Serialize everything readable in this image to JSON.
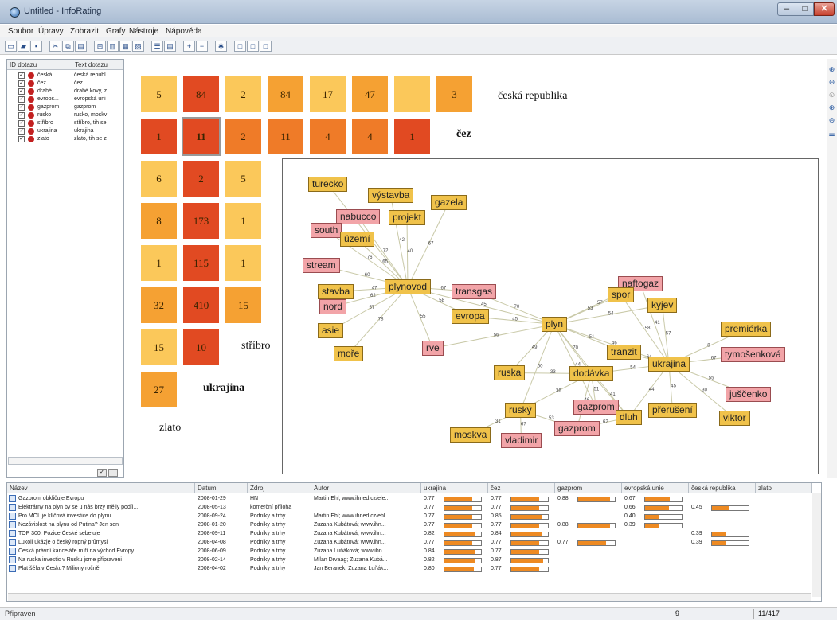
{
  "window": {
    "title": "Untitled - InfoRating",
    "min": "–",
    "max": "□",
    "close": "✕"
  },
  "menu": [
    "Soubor",
    "Úpravy",
    "Zobrazit",
    "Grafy",
    "Nástroje",
    "Nápověda"
  ],
  "left_panel": {
    "headers": [
      "ID dotazu",
      "Text dotazu"
    ],
    "queries": [
      {
        "id": "česká ...",
        "text": "česká republ"
      },
      {
        "id": "čez",
        "text": "čez"
      },
      {
        "id": "drahé ...",
        "text": "drahé kovy, z"
      },
      {
        "id": "evrops...",
        "text": "evropská uni"
      },
      {
        "id": "gazprom",
        "text": "gazprom"
      },
      {
        "id": "rusko",
        "text": "rusko, moskv"
      },
      {
        "id": "stříbro",
        "text": "stříbro, tih se"
      },
      {
        "id": "ukrajina",
        "text": "ukrajina"
      },
      {
        "id": "zlato",
        "text": "zlato, tih se z"
      }
    ]
  },
  "matrix": {
    "cells": [
      [
        "5",
        "84",
        "2",
        "84",
        "17",
        "47",
        "",
        "3"
      ],
      [
        "1",
        "11",
        "2",
        "11",
        "4",
        "4",
        "1"
      ],
      [
        "6",
        "2",
        "5"
      ],
      [
        "8",
        "173",
        "1"
      ],
      [
        "1",
        "115",
        "1"
      ],
      [
        "32",
        "410",
        "15"
      ],
      [
        "15",
        "10"
      ],
      [
        "27"
      ]
    ],
    "labels": {
      "ceska_republika": "česká republika",
      "cez": "čez",
      "stribro": "stříbro",
      "ukrajina": "ukrajina",
      "zlato": "zlato"
    }
  },
  "network": {
    "nodes": [
      "turecko",
      "výstavba",
      "gazela",
      "nabucco",
      "projekt",
      "south",
      "území",
      "stream",
      "plynovod",
      "transgas",
      "naftogaz",
      "spor",
      "kyjev",
      "stavba",
      "nord",
      "evropa",
      "plyn",
      "asie",
      "moře",
      "rve",
      "premiérka",
      "tymošenková",
      "tranzit",
      "ukrajina",
      "ruska",
      "dodávka",
      "juščenko",
      "ruský",
      "gazprom_pink",
      "dluh",
      "přerušení",
      "viktor",
      "moskva",
      "vladimir",
      "gazprom"
    ],
    "labels": {
      "turecko": "turecko",
      "výstavba": "výstavba",
      "gazela": "gazela",
      "nabucco": "nabucco",
      "projekt": "projekt",
      "south": "south",
      "území": "území",
      "stream": "stream",
      "plynovod": "plynovod",
      "transgas": "transgas",
      "naftogaz": "naftogaz",
      "spor": "spor",
      "kyjev": "kyjev",
      "stavba": "stavba",
      "nord": "nord",
      "evropa": "evropa",
      "plyn": "plyn",
      "asie": "asie",
      "moře": "moře",
      "rve": "rve",
      "premiérka": "premiérka",
      "tymošenková": "tymošenková",
      "tranzit": "tranzit",
      "ukrajina": "ukrajina",
      "ruska": "ruska",
      "dodávka": "dodávka",
      "juščenko": "juščenko",
      "ruský": "ruský",
      "gazprom_pink": "gazprom",
      "dluh": "dluh",
      "přerušení": "přerušení",
      "viktor": "viktor",
      "moskva": "moskva",
      "vladimir": "vladimir",
      "gazprom": "gazprom"
    },
    "edges": [
      [
        "turecko",
        "plynovod",
        "61"
      ],
      [
        "výstavba",
        "plynovod",
        "42"
      ],
      [
        "gazela",
        "plynovod",
        "67"
      ],
      [
        "nabucco",
        "plynovod",
        "72"
      ],
      [
        "projekt",
        "plynovod",
        "40"
      ],
      [
        "south",
        "plynovod",
        "76"
      ],
      [
        "území",
        "plynovod",
        "65"
      ],
      [
        "stream",
        "plynovod",
        "60"
      ],
      [
        "stavba",
        "plynovod",
        "47"
      ],
      [
        "nord",
        "plynovod",
        "62"
      ],
      [
        "asie",
        "plynovod",
        "57"
      ],
      [
        "moře",
        "plynovod",
        "78"
      ],
      [
        "plynovod",
        "transgas",
        "67"
      ],
      [
        "plynovod",
        "evropa",
        "58"
      ],
      [
        "plynovod",
        "rve",
        "55"
      ],
      [
        "plynovod",
        "plyn",
        "45"
      ],
      [
        "evropa",
        "plyn",
        "45"
      ],
      [
        "rve",
        "plyn",
        "56"
      ],
      [
        "transgas",
        "plyn",
        "70"
      ],
      [
        "plyn",
        "naftogaz",
        "57"
      ],
      [
        "plyn",
        "spor",
        "53"
      ],
      [
        "plyn",
        "kyjev",
        "54"
      ],
      [
        "plyn",
        "tranzit",
        "51"
      ],
      [
        "plyn",
        "ukrajina",
        "46"
      ],
      [
        "plyn",
        "ruska",
        "49"
      ],
      [
        "plyn",
        "dodávka",
        "70"
      ],
      [
        "plyn",
        "ruský",
        "60"
      ],
      [
        "plyn",
        "gazprom_pink",
        "44"
      ],
      [
        "plyn",
        "dluh",
        "49"
      ],
      [
        "kyjev",
        "ukrajina",
        "57"
      ],
      [
        "spor",
        "ukrajina",
        "58"
      ],
      [
        "naftogaz",
        "ukrajina",
        "41"
      ],
      [
        "tranzit",
        "ukrajina",
        "64"
      ],
      [
        "ukrajina",
        "premiérka",
        "8"
      ],
      [
        "ukrajina",
        "tymošenková",
        "67"
      ],
      [
        "ukrajina",
        "juščenko",
        "55"
      ],
      [
        "ukrajina",
        "viktor",
        "30"
      ],
      [
        "ukrajina",
        "přerušení",
        "45"
      ],
      [
        "ukrajina",
        "dodávka",
        "54"
      ],
      [
        "ukrajina",
        "dluh",
        "44"
      ],
      [
        "ruska",
        "dodávka",
        "33"
      ],
      [
        "dodávka",
        "ruský",
        "36"
      ],
      [
        "dodávka",
        "gazprom",
        "46"
      ],
      [
        "dodávka",
        "dluh",
        "41"
      ],
      [
        "ruský",
        "moskva",
        "31"
      ],
      [
        "ruský",
        "vladimir",
        "67"
      ],
      [
        "ruský",
        "gazprom",
        "53"
      ],
      [
        "gazprom_pink",
        "dodávka",
        "51"
      ],
      [
        "gazprom",
        "dluh",
        "62"
      ]
    ]
  },
  "bottom_table": {
    "headers": [
      "Název",
      "Datum",
      "Zdroj",
      "Autor",
      "ukrajina",
      "čez",
      "gazprom",
      "evropská unie",
      "česká republika",
      "zlato"
    ],
    "rows": [
      {
        "title": "Gazprom obkličuje Evropu",
        "date": "2008-01-29",
        "source": "HN",
        "author": "Martin Ehl; www.ihned.cz/ele...",
        "ukr": "0.77",
        "ukr_fill": 0.77,
        "cez": "0.77",
        "cez_fill": 0.77,
        "gaz": "0.88",
        "gaz_fill": 0.88,
        "eu": "0.67",
        "eu_fill": 0.67,
        "cr": "",
        "cr_fill": 0
      },
      {
        "title": "Elektrárny na plyn by se u nás brzy mělly podíl...",
        "date": "2008-05-13",
        "source": "komerční příloha",
        "author": "",
        "ukr": "0.77",
        "ukr_fill": 0.77,
        "cez": "0.77",
        "cez_fill": 0.77,
        "gaz": "",
        "gaz_fill": 0,
        "eu": "0.66",
        "eu_fill": 0.66,
        "cr": "0.45",
        "cr_fill": 0.45
      },
      {
        "title": "Pro MOL je klíčová investice do plynu",
        "date": "2008-09-24",
        "source": "Podniky a trhy",
        "author": "Martin Ehl; www.ihned.cz/ehl",
        "ukr": "0.77",
        "ukr_fill": 0.77,
        "cez": "0.85",
        "cez_fill": 0.85,
        "gaz": "",
        "gaz_fill": 0,
        "eu": "0.40",
        "eu_fill": 0.4,
        "cr": "",
        "cr_fill": 0
      },
      {
        "title": "Nezávislost na plynu od Putina? Jen sen",
        "date": "2008-01-20",
        "source": "Podniky a trhy",
        "author": "Zuzana Kubátová; www.ihn...",
        "ukr": "0.77",
        "ukr_fill": 0.77,
        "cez": "0.77",
        "cez_fill": 0.77,
        "gaz": "0.88",
        "gaz_fill": 0.88,
        "eu": "0.39",
        "eu_fill": 0.39,
        "cr": "",
        "cr_fill": 0
      },
      {
        "title": "TOP 300: Pozice České sebeluje",
        "date": "2008-09-11",
        "source": "Podniky a trhy",
        "author": "Zuzana Kubátová; www.ihn...",
        "ukr": "0.82",
        "ukr_fill": 0.82,
        "cez": "0.84",
        "cez_fill": 0.84,
        "gaz": "",
        "gaz_fill": 0,
        "eu": "",
        "eu_fill": 0,
        "cr": "0.39",
        "cr_fill": 0.39
      },
      {
        "title": "Lukoil ukázje o český ropný průmysl",
        "date": "2008-04-08",
        "source": "Podniky a trhy",
        "author": "Zuzana Kubátová; www.ihn...",
        "ukr": "0.77",
        "ukr_fill": 0.77,
        "cez": "0.77",
        "cez_fill": 0.77,
        "gaz": "0.77",
        "gaz_fill": 0.77,
        "eu": "",
        "eu_fill": 0,
        "cr": "0.39",
        "cr_fill": 0.39
      },
      {
        "title": "Česká právní kanceláře míří na východ Evropy",
        "date": "2008-06-09",
        "source": "Podniky a trhy",
        "author": "Zuzana Luňáková; www.ihn...",
        "ukr": "0.84",
        "ukr_fill": 0.84,
        "cez": "0.77",
        "cez_fill": 0.77,
        "gaz": "",
        "gaz_fill": 0,
        "eu": "",
        "eu_fill": 0,
        "cr": "",
        "cr_fill": 0
      },
      {
        "title": "Na ruska investic v Rusku jsme připraveni",
        "date": "2008-02-14",
        "source": "Podniky a trhy",
        "author": "Milan Drvaag; Zuzana Kubá...",
        "ukr": "0.82",
        "ukr_fill": 0.82,
        "cez": "0.87",
        "cez_fill": 0.87,
        "gaz": "",
        "gaz_fill": 0,
        "eu": "",
        "eu_fill": 0,
        "cr": "",
        "cr_fill": 0
      },
      {
        "title": "Plat šéfa v Česku? Miliony ročně",
        "date": "2008-04-02",
        "source": "Podniky a trhy",
        "author": "Jan Beranek; Zuzana Luňák...",
        "ukr": "0.80",
        "ukr_fill": 0.8,
        "cez": "0.77",
        "cez_fill": 0.77,
        "gaz": "",
        "gaz_fill": 0,
        "eu": "",
        "eu_fill": 0,
        "cr": "",
        "cr_fill": 0
      }
    ]
  },
  "status": {
    "text": "Připraven",
    "selected": "9",
    "count": "11/417"
  },
  "colors": {
    "light": "#fbc85a",
    "mid": "#f5a133",
    "orange": "#ef7b28",
    "dark": "#e14a22",
    "node_yellow": "#f0c24a",
    "node_pink": "#f2a4a8",
    "bar": "#ee8a22"
  }
}
